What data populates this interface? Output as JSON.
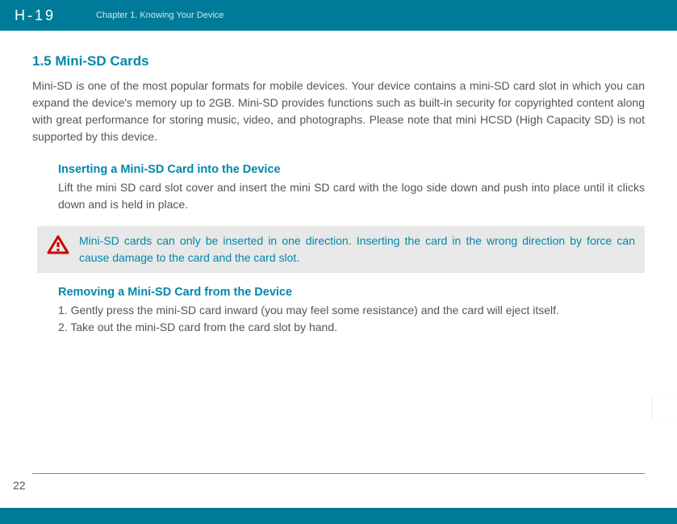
{
  "header": {
    "logo": "H-19",
    "chapter": "Chapter 1. Knowing Your Device"
  },
  "section": {
    "heading": "1.5 Mini-SD Cards",
    "intro": "Mini-SD is one of the most popular formats for mobile devices. Your device contains a mini-SD card slot in which you can expand the device's memory up to 2GB. Mini-SD provides functions such as built-in security for copyrighted content along with great performance for storing music, video, and photographs. Please note that mini HCSD (High Capacity SD) is not supported by this device."
  },
  "inserting": {
    "heading": "Inserting a Mini-SD Card into the Device",
    "text": "Lift the mini SD card slot cover and insert the mini SD card with the logo side down and push into place until it clicks down and is held in place."
  },
  "warning": {
    "text": "Mini-SD cards can only be inserted in one direction. Inserting the card in the wrong direction by force can cause damage to the card and the card slot."
  },
  "removing": {
    "heading": "Removing a Mini-SD Card from the Device",
    "step1": "1. Gently press the mini-SD card inward (you may feel some resistance) and the card will eject itself.",
    "step2": "2. Take out the mini-SD card from the card slot by hand."
  },
  "pageNumber": "22"
}
